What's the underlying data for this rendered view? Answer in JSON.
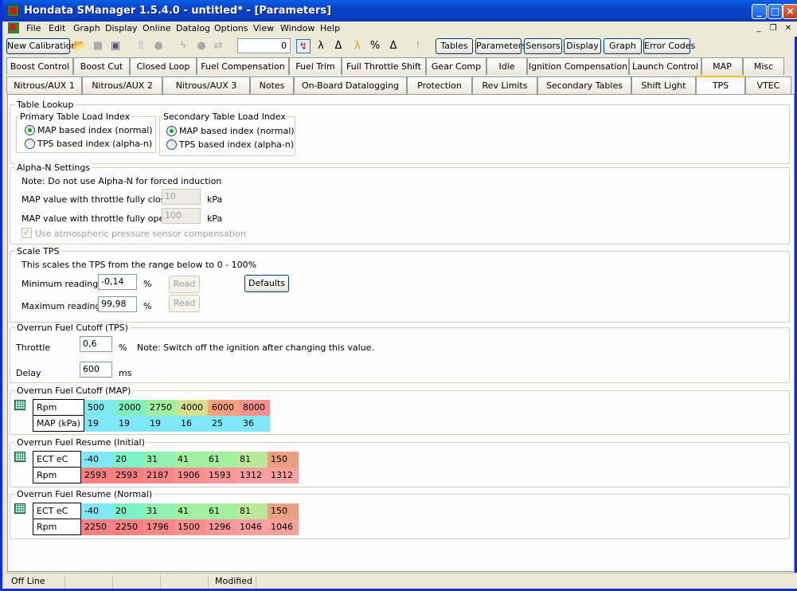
{
  "window": {
    "title": "Hondata SManager 1.5.4.0 - untitled* - [Parameters]"
  },
  "menu": [
    "File",
    "Edit",
    "Graph",
    "Display",
    "Online",
    "Datalog",
    "Options",
    "View",
    "Window",
    "Help"
  ],
  "toolbar": {
    "new_calibration": "New Calibration",
    "counter": "0",
    "right_buttons": [
      "Tables",
      "Parameters",
      "Sensors",
      "Display",
      "Graph",
      "Error Codes"
    ]
  },
  "tabs_row1": [
    "Boost Control",
    "Boost Cut",
    "Closed Loop",
    "Fuel Compensation",
    "Fuel Trim",
    "Full Throttle Shift",
    "Gear Comp",
    "Idle",
    "Ignition Compensation",
    "Launch Control",
    "MAP",
    "Misc"
  ],
  "tabs_row2": [
    "Nitrous/AUX 1",
    "Nitrous/AUX 2",
    "Nitrous/AUX 3",
    "Notes",
    "On-Board Datalogging",
    "Protection",
    "Rev Limits",
    "Secondary Tables",
    "Shift Light",
    "TPS",
    "VTEC"
  ],
  "table_lookup": {
    "title": "Table Lookup",
    "primary": {
      "title": "Primary Table Load Index",
      "opt1": "MAP based index (normal)",
      "opt2": "TPS based index (alpha-n)"
    },
    "secondary": {
      "title": "Secondary Table Load Index",
      "opt1": "MAP based index (normal)",
      "opt2": "TPS based index (alpha-n)"
    }
  },
  "alpha_n": {
    "title": "Alpha-N Settings",
    "note": "Note: Do not use Alpha-N for forced induction",
    "closed_label": "MAP value with throttle fully closed",
    "closed_value": "10",
    "open_label": "MAP value with throttle fully open",
    "open_value": "100",
    "unit": "kPa",
    "atmo_label": "Use atmospheric pressure sensor compensation"
  },
  "scale_tps": {
    "title": "Scale TPS",
    "note": "This scales the TPS from the range below to 0 - 100%",
    "min_label": "Minimum reading",
    "min_value": "-0,14",
    "max_label": "Maximum reading",
    "max_value": "99,98",
    "unit": "%",
    "read": "Read",
    "defaults": "Defaults"
  },
  "overrun_tps": {
    "title": "Overrun Fuel Cutoff (TPS)",
    "throttle_label": "Throttle",
    "throttle_value": "0,6",
    "throttle_unit": "%",
    "note": "Note: Switch off the ignition after changing this value.",
    "delay_label": "Delay",
    "delay_value": "600",
    "delay_unit": "ms"
  },
  "overrun_map": {
    "title": "Overrun Fuel Cutoff (MAP)",
    "row1_label": "Rpm",
    "row1": [
      "500",
      "2000",
      "2750",
      "4000",
      "6000",
      "8000"
    ],
    "row2_label": "MAP (kPa)",
    "row2": [
      "19",
      "19",
      "19",
      "16",
      "25",
      "36"
    ],
    "row1_colors": [
      "#80e8f0",
      "#80f0c0",
      "#a0f0a0",
      "#d8e090",
      "#f8a080",
      "#f89090"
    ],
    "row2_colors": [
      "#80e8f8",
      "#80e8f8",
      "#80e8f8",
      "#80e8f8",
      "#80e8f8",
      "#80e8f8"
    ]
  },
  "resume_initial": {
    "title": "Overrun Fuel Resume (Initial)",
    "row1_label": "ECT eC",
    "row1": [
      "-40",
      "20",
      "31",
      "41",
      "61",
      "81",
      "150"
    ],
    "row2_label": "Rpm",
    "row2": [
      "2593",
      "2593",
      "2187",
      "1906",
      "1593",
      "1312",
      "1312"
    ],
    "row1_colors": [
      "#80e8f8",
      "#80f0c8",
      "#90f0b0",
      "#a0f0a0",
      "#a0f0a0",
      "#b8e898",
      "#e8a080"
    ],
    "row2_colors": [
      "#f88080",
      "#f88080",
      "#f88888",
      "#f89090",
      "#f89898",
      "#f8a0a0",
      "#f8a0a0"
    ]
  },
  "resume_normal": {
    "title": "Overrun Fuel Resume (Normal)",
    "row1_label": "ECT eC",
    "row1": [
      "-40",
      "20",
      "31",
      "41",
      "61",
      "81",
      "150"
    ],
    "row2_label": "Rpm",
    "row2": [
      "2250",
      "2250",
      "1796",
      "1500",
      "1296",
      "1046",
      "1046"
    ],
    "row1_colors": [
      "#80e8f8",
      "#80f0c8",
      "#90f0b0",
      "#a0f0a0",
      "#a0f0a0",
      "#b8e898",
      "#e8a080"
    ],
    "row2_colors": [
      "#f88080",
      "#f88080",
      "#f88888",
      "#f89090",
      "#f89898",
      "#f8a0a0",
      "#f8a0a0"
    ]
  },
  "status": {
    "left": "Off Line",
    "modified": "Modified"
  }
}
